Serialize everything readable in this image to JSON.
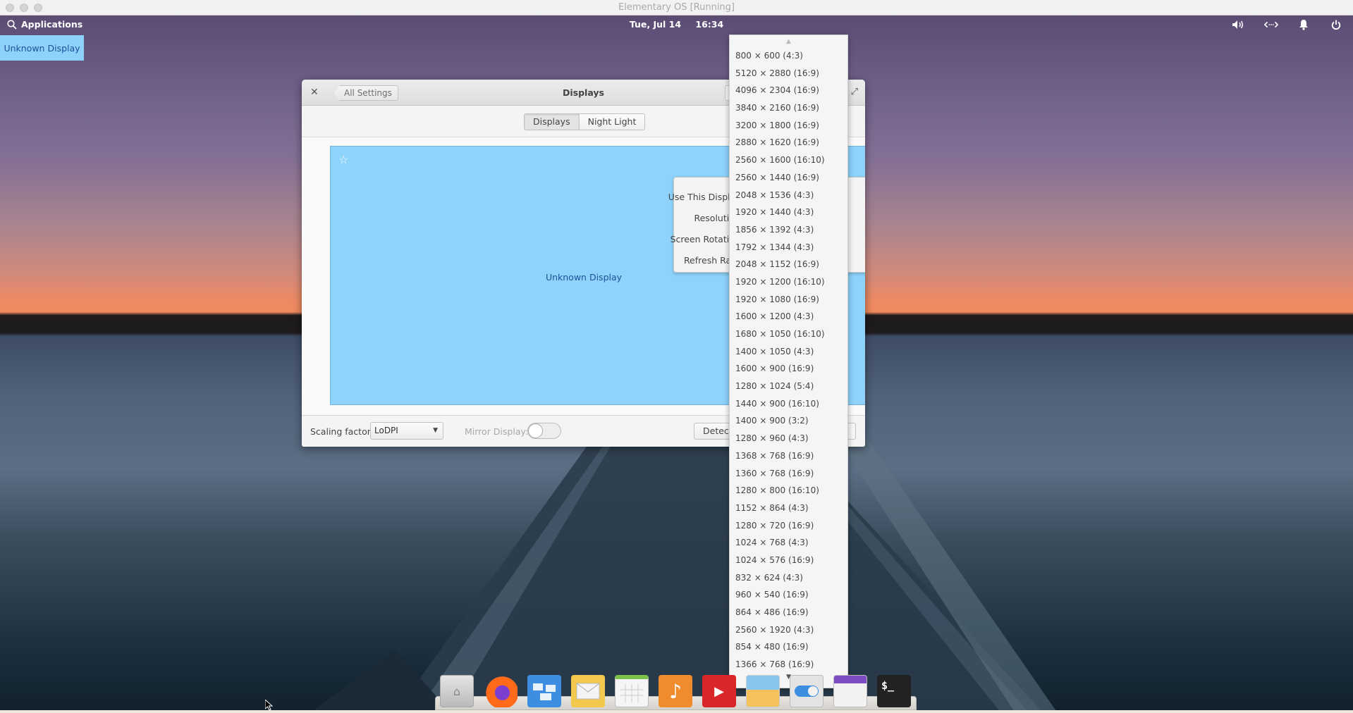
{
  "host_window": {
    "title": "Elementary OS [Running]"
  },
  "panel": {
    "applications_label": "Applications",
    "date": "Tue, Jul 14",
    "time": "16:34",
    "indicators": [
      "volume-icon",
      "network-icon",
      "notifications-icon",
      "power-icon"
    ]
  },
  "display_badge": {
    "label": "Unknown Display"
  },
  "settings_window": {
    "title": "Displays",
    "back_label": "All Settings",
    "tabs": [
      {
        "label": "Displays",
        "active": true
      },
      {
        "label": "Night Light",
        "active": false
      }
    ],
    "canvas": {
      "display_name": "Unknown Display",
      "color": "#8dd3fb"
    },
    "popover_labels": {
      "use_display": "Use This Display:",
      "resolution": "Resolution:",
      "rotation": "Screen Rotation:",
      "refresh_rate": "Refresh Rate:"
    },
    "footer": {
      "scaling_label": "Scaling factor:",
      "scaling_value": "LoDPI",
      "mirror_label": "Mirror Display:",
      "mirror_on": false,
      "detect_label": "Detect Displays"
    }
  },
  "resolution_menu": {
    "items": [
      "800 × 600 (4:3)",
      "5120 × 2880 (16:9)",
      "4096 × 2304 (16:9)",
      "3840 × 2160 (16:9)",
      "3200 × 1800 (16:9)",
      "2880 × 1620 (16:9)",
      "2560 × 1600 (16:10)",
      "2560 × 1440 (16:9)",
      "2048 × 1536 (4:3)",
      "1920 × 1440 (4:3)",
      "1856 × 1392 (4:3)",
      "1792 × 1344 (4:3)",
      "2048 × 1152 (16:9)",
      "1920 × 1200 (16:10)",
      "1920 × 1080 (16:9)",
      "1600 × 1200 (4:3)",
      "1680 × 1050 (16:10)",
      "1400 × 1050 (4:3)",
      "1600 × 900 (16:9)",
      "1280 × 1024 (5:4)",
      "1440 × 900 (16:10)",
      "1400 × 900 (3:2)",
      "1280 × 960 (4:3)",
      "1368 × 768 (16:9)",
      "1360 × 768 (16:9)",
      "1280 × 800 (16:10)",
      "1152 × 864 (4:3)",
      "1280 × 720 (16:9)",
      "1024 × 768 (4:3)",
      "1024 × 576 (16:9)",
      "832 × 624 (4:3)",
      "960 × 540 (16:9)",
      "864 × 486 (16:9)",
      "2560 × 1920 (4:3)",
      "854 × 480 (16:9)",
      "1366 × 768 (16:9)"
    ]
  },
  "dock": {
    "apps": [
      {
        "name": "files",
        "icon": "folder-home-icon"
      },
      {
        "name": "firefox",
        "icon": "firefox-icon"
      },
      {
        "name": "multitasking-view",
        "icon": "multitasking-icon"
      },
      {
        "name": "mail",
        "icon": "mail-icon"
      },
      {
        "name": "calendar",
        "icon": "calendar-icon"
      },
      {
        "name": "music",
        "icon": "music-icon"
      },
      {
        "name": "videos",
        "icon": "video-icon"
      },
      {
        "name": "photos",
        "icon": "photos-icon"
      },
      {
        "name": "system-settings",
        "icon": "settings-toggle-icon"
      },
      {
        "name": "appcenter",
        "icon": "store-icon"
      },
      {
        "name": "terminal",
        "icon": "terminal-icon"
      }
    ]
  }
}
